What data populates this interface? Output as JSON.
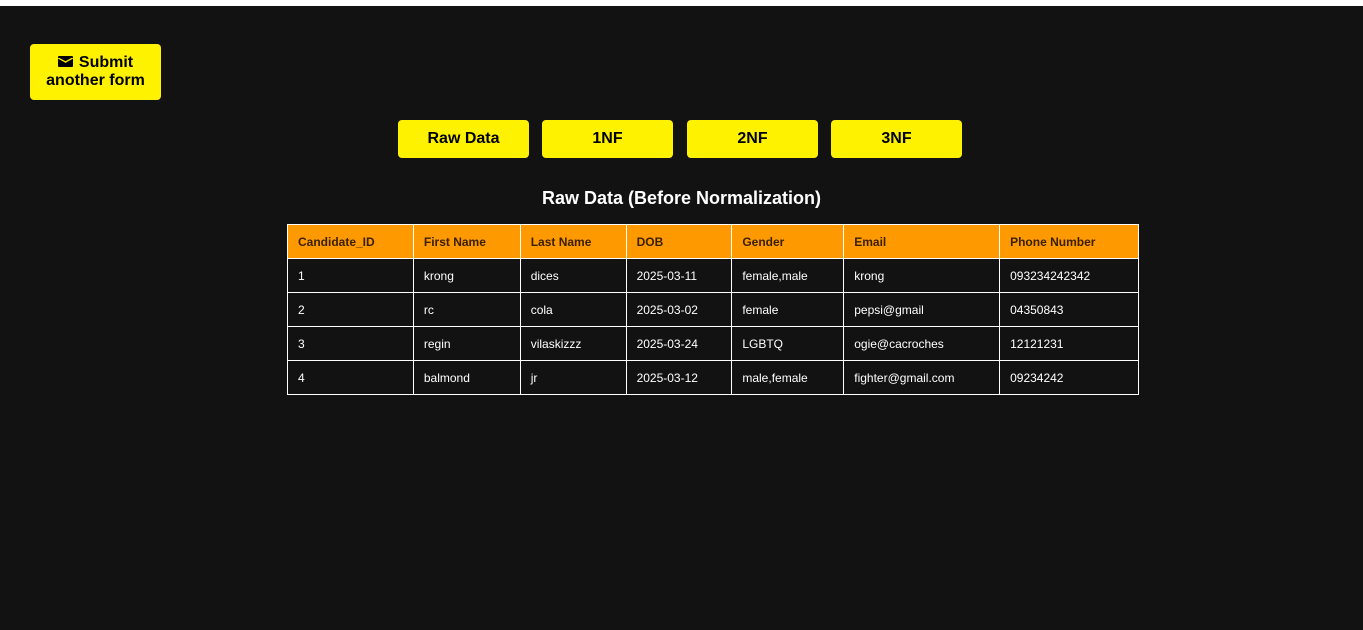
{
  "actions": {
    "submit_line1": "Submit",
    "submit_line2": "another form",
    "submit_icon": "envelope-icon"
  },
  "tabs": [
    {
      "label": "Raw Data"
    },
    {
      "label": "1NF"
    },
    {
      "label": "2NF"
    },
    {
      "label": "3NF"
    }
  ],
  "section_title": "Raw Data (Before Normalization)",
  "table": {
    "columns": [
      "Candidate_ID",
      "First Name",
      "Last Name",
      "DOB",
      "Gender",
      "Email",
      "Phone Number"
    ],
    "rows": [
      [
        "1",
        "krong",
        "dices",
        "2025-03-11",
        "female,male",
        "krong",
        "093234242342"
      ],
      [
        "2",
        "rc",
        "cola",
        "2025-03-02",
        "female",
        "pepsi@gmail",
        "04350843"
      ],
      [
        "3",
        "regin",
        "vilaskizzz",
        "2025-03-24",
        "LGBTQ",
        "ogie@cacroches",
        "12121231"
      ],
      [
        "4",
        "balmond",
        "jr",
        "2025-03-12",
        "male,female",
        "fighter@gmail.com",
        "09234242"
      ]
    ]
  },
  "colors": {
    "background": "#121212",
    "button": "#fff200",
    "header": "#ff9900"
  }
}
